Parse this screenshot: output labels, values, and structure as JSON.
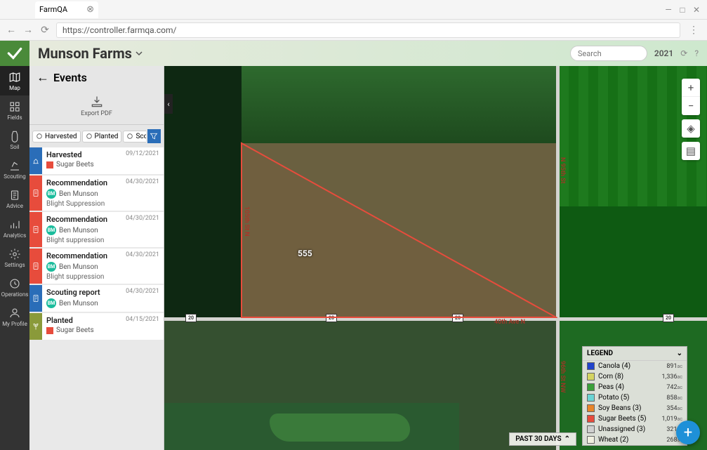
{
  "browser": {
    "tab_title": "FarmQA",
    "url": "https://controller.farmqa.com/"
  },
  "header": {
    "org_name": "Munson Farms",
    "search_placeholder": "Search",
    "year": "2021"
  },
  "nav": {
    "items": [
      {
        "id": "map",
        "label": "Map"
      },
      {
        "id": "fields",
        "label": "Fields"
      },
      {
        "id": "soil",
        "label": "Soil"
      },
      {
        "id": "scouting",
        "label": "Scouting"
      },
      {
        "id": "advice",
        "label": "Advice"
      },
      {
        "id": "analytics",
        "label": "Analytics"
      },
      {
        "id": "settings",
        "label": "Settings"
      },
      {
        "id": "operations",
        "label": "Operations"
      },
      {
        "id": "profile",
        "label": "My Profile"
      }
    ]
  },
  "panel": {
    "title": "Events",
    "export_label": "Export PDF",
    "chips": [
      {
        "icon": "harvest",
        "label": "Harvested"
      },
      {
        "icon": "plant",
        "label": "Planted"
      },
      {
        "icon": "scout",
        "label": "Sco"
      }
    ]
  },
  "events": [
    {
      "type": "blue",
      "icon": "harvest",
      "title": "Harvested",
      "date": "09/12/2021",
      "crop": "Sugar Beets",
      "crop_color": "#e74c3c"
    },
    {
      "type": "red",
      "icon": "rec",
      "title": "Recommendation",
      "date": "04/30/2021",
      "person": "Ben Munson",
      "initials": "BM",
      "note": "Blight Suppression"
    },
    {
      "type": "red",
      "icon": "rec",
      "title": "Recommendation",
      "date": "04/30/2021",
      "person": "Ben Munson",
      "initials": "BM",
      "note": "Blight suppression"
    },
    {
      "type": "red",
      "icon": "rec",
      "title": "Recommendation",
      "date": "04/30/2021",
      "person": "Ben Munson",
      "initials": "BM",
      "note": "Blight suppression"
    },
    {
      "type": "blue",
      "icon": "scout",
      "title": "Scouting report",
      "date": "04/30/2021",
      "person": "Ben Munson",
      "initials": "BM"
    },
    {
      "type": "olive",
      "icon": "plant",
      "title": "Planted",
      "date": "04/15/2021",
      "crop": "Sugar Beets",
      "crop_color": "#e74c3c"
    }
  ],
  "map": {
    "field_label": "555",
    "road_h_label": "40th Ave N",
    "road_v1_label": "105th St N",
    "road_v2_label": "N 95th St",
    "road_v3_label": "96th St NW",
    "shields": [
      "20",
      "20",
      "20",
      "20"
    ],
    "time_filter": "PAST 30 DAYS"
  },
  "legend": {
    "title": "LEGEND",
    "unit": "ac",
    "rows": [
      {
        "color": "#2244cc",
        "name": "Canola (4)",
        "acres": "891"
      },
      {
        "color": "#d4d462",
        "name": "Corn (8)",
        "acres": "1,336"
      },
      {
        "color": "#3aa03a",
        "name": "Peas (4)",
        "acres": "742"
      },
      {
        "color": "#6ad4d4",
        "name": "Potato (5)",
        "acres": "858"
      },
      {
        "color": "#e8852a",
        "name": "Soy Beans (3)",
        "acres": "354"
      },
      {
        "color": "#e74c3c",
        "name": "Sugar Beets (5)",
        "acres": "1,019"
      },
      {
        "color": "#d0d0d0",
        "name": "Unassigned (3)",
        "acres": "321"
      },
      {
        "color": "#f0f0e0",
        "name": "Wheat (2)",
        "acres": "268"
      }
    ]
  }
}
